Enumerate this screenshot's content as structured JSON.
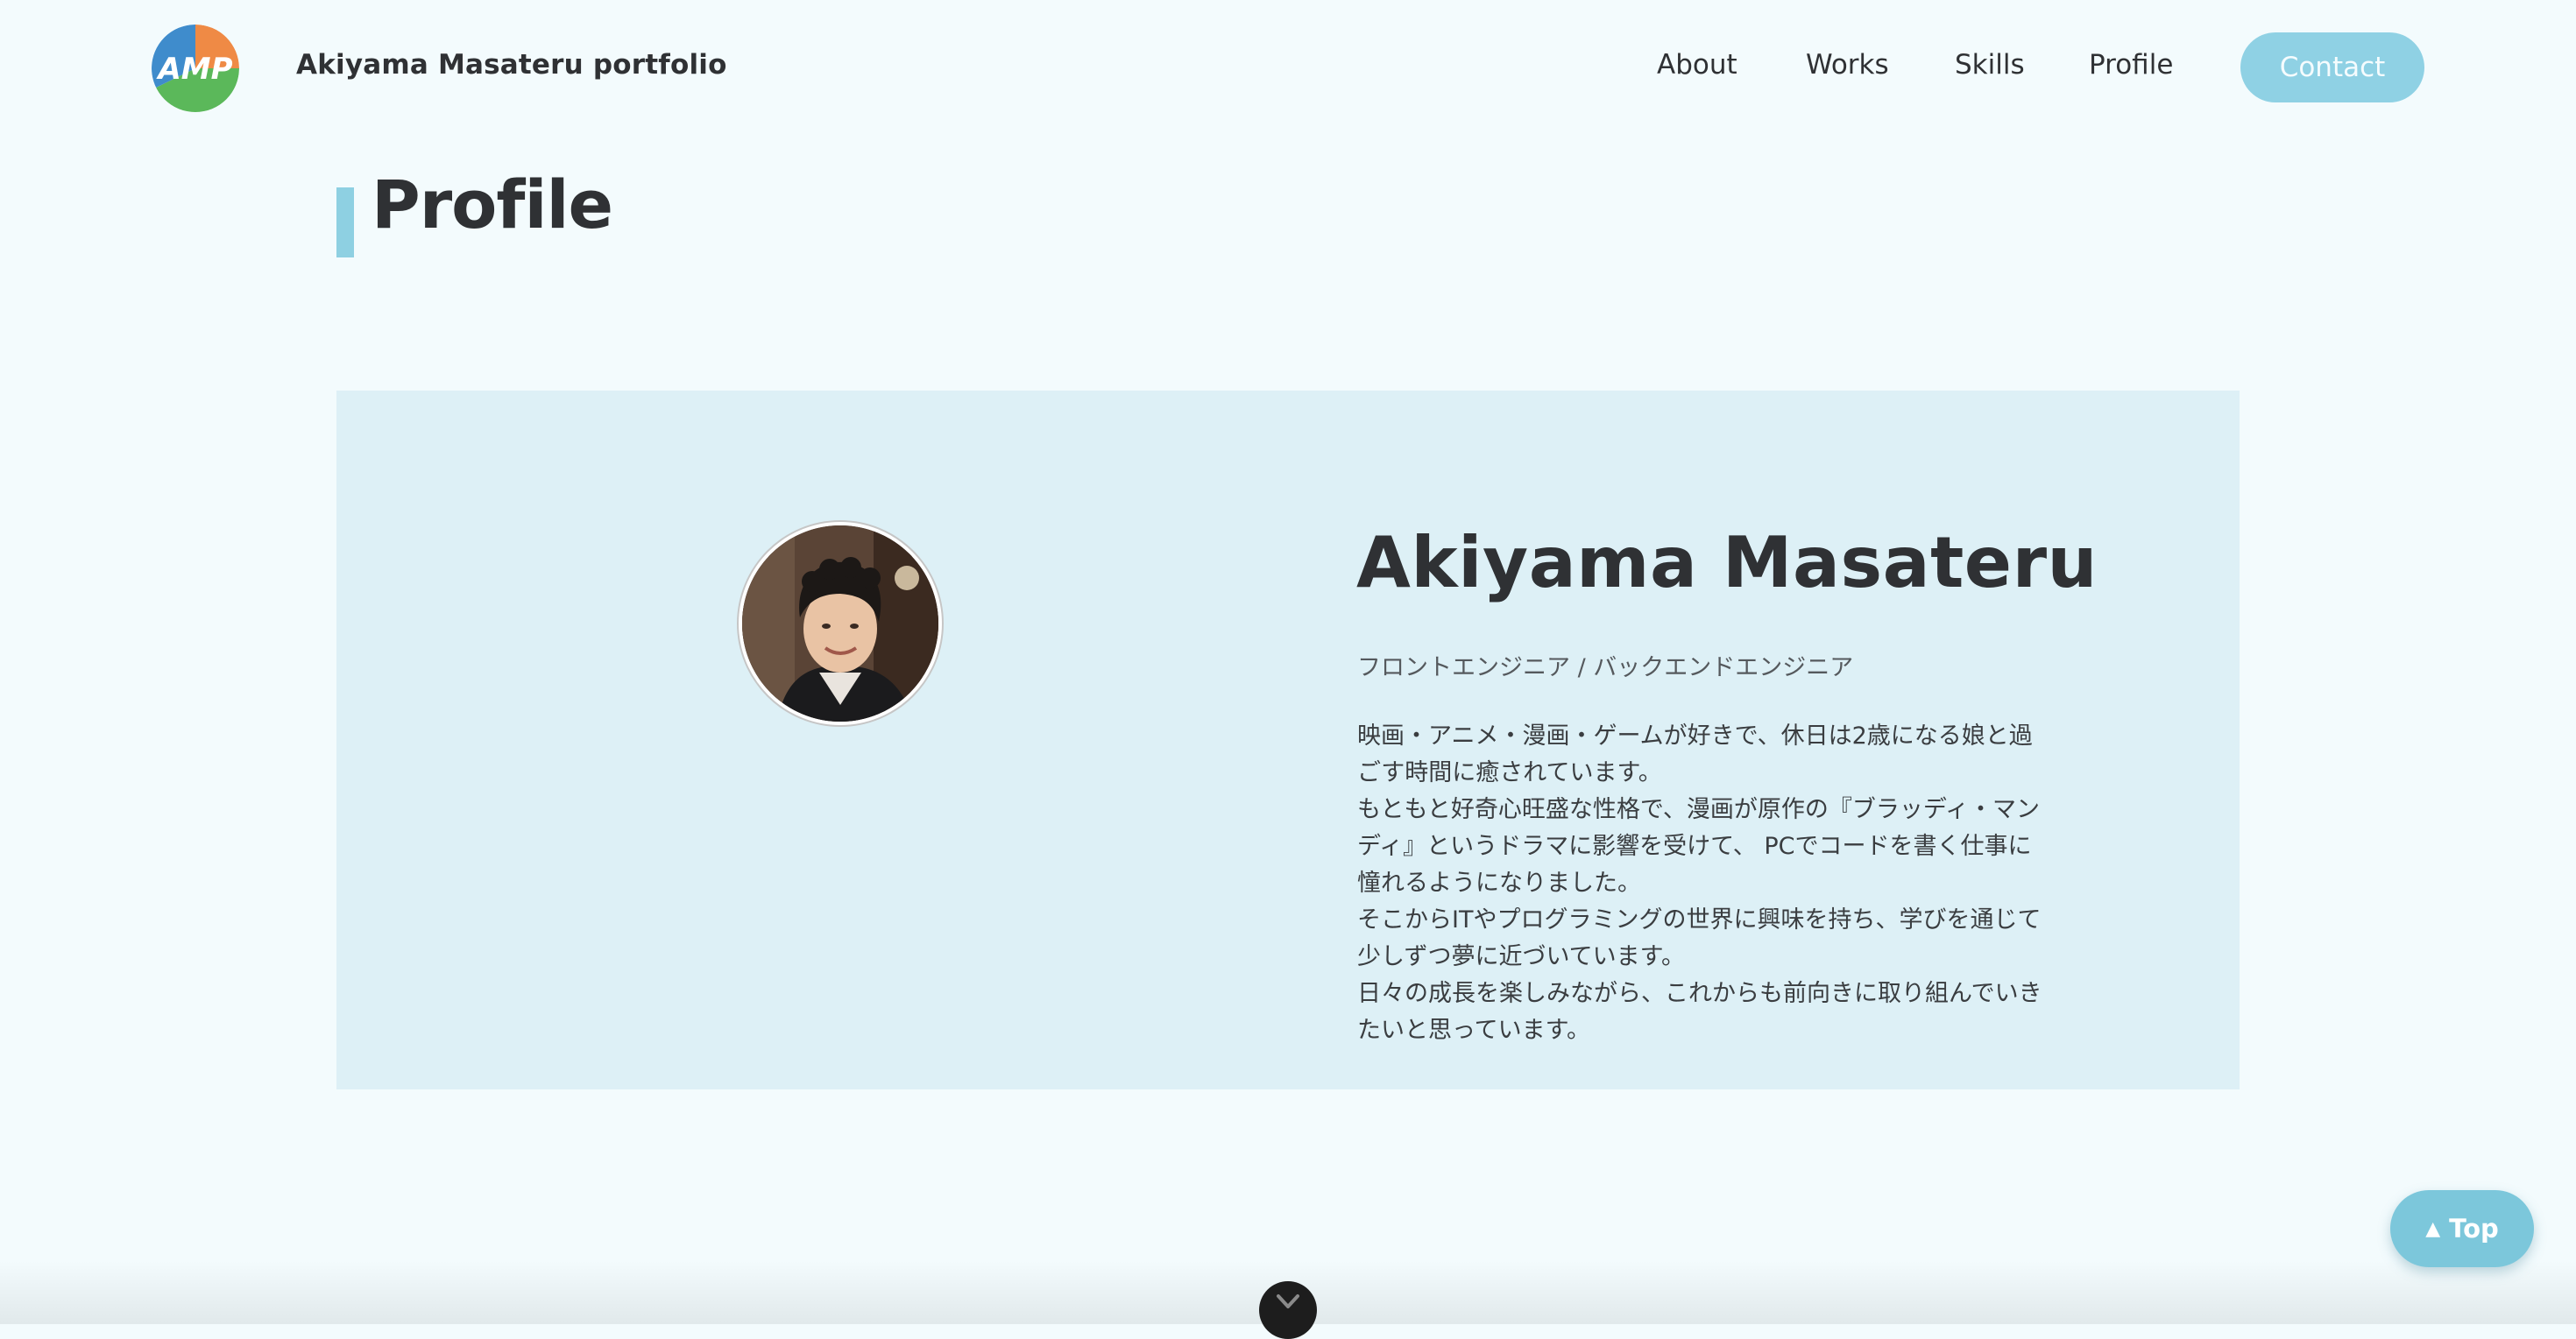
{
  "header": {
    "logo_text": "AMP",
    "site_title": "Akiyama Masateru portfolio",
    "nav": [
      {
        "label": "About"
      },
      {
        "label": "Works"
      },
      {
        "label": "Skills"
      },
      {
        "label": "Profile"
      }
    ],
    "contact_label": "Contact"
  },
  "section": {
    "title": "Profile"
  },
  "profile": {
    "name": "Akiyama Masateru",
    "role": "フロントエンジニア / バックエンドエンジニア",
    "bio_lines": [
      "映画・アニメ・漫画・ゲームが好きで、休日は2歳になる娘と過",
      "ごす時間に癒されています。",
      "もともと好奇心旺盛な性格で、漫画が原作の『ブラッディ・マン",
      "ディ』というドラマに影響を受けて、 PCでコードを書く仕事に",
      "憧れるようになりました。",
      "そこからITやプログラミングの世界に興味を持ち、学びを通じて",
      "少しずつ夢に近づいています。",
      "日々の成長を楽しみながら、これからも前向きに取り組んでいき",
      "たいと思っています。"
    ]
  },
  "top_button": {
    "arrow": "▲",
    "label": "Top"
  },
  "colors": {
    "background": "#f3fbfd",
    "card": "#ddf0f6",
    "accent": "#8ed0e2",
    "text": "#2f3134"
  },
  "icons": {
    "logo": "amp-logo",
    "scroll": "chevron-down-icon",
    "top": "triangle-up-icon"
  }
}
